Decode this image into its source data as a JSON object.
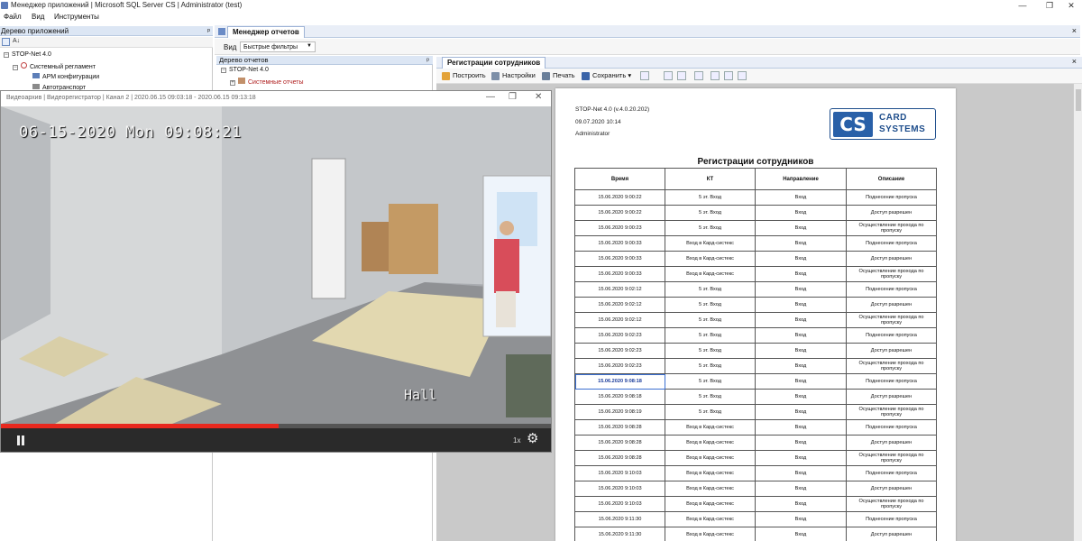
{
  "window": {
    "title": "Менеджер приложений | Microsoft SQL Server CS | Administrator  (test)",
    "controls": [
      "—",
      "❐",
      "✕"
    ]
  },
  "menu": [
    "Файл",
    "Вид",
    "Инструменты"
  ],
  "app_tree": {
    "header": "Дерево приложений",
    "pin": "ᵖ",
    "items": [
      {
        "label": "STOP-Net 4.0"
      },
      {
        "label": "Системный регламент"
      },
      {
        "label": "АРМ конфигурации"
      },
      {
        "label": "Автотранспорт"
      }
    ]
  },
  "report_manager": {
    "tab": "Менеджер отчетов",
    "close": "×",
    "view_label": "Вид",
    "view_select": "Быстрые фильтры",
    "tree_header": "Дерево отчетов",
    "tree_items": [
      {
        "label": "STOP-Net 4.0"
      },
      {
        "label": "Системные отчеты"
      }
    ]
  },
  "report_panel": {
    "tab": "Регистрации сотрудников",
    "close": "×",
    "toolbar": {
      "build": "Построить",
      "settings": "Настройки",
      "print": "Печать",
      "save": "Сохранить"
    }
  },
  "report": {
    "product": "STOP-Net 4.0 (v.4.0.20.202)",
    "date": "09.07.2020 10:14",
    "user": "Administrator",
    "logo_mark": "CS",
    "logo_line1": "CARD",
    "logo_line2": "SYSTEMS",
    "title": "Регистрации сотрудников",
    "columns": [
      "Время",
      "КТ",
      "Направление",
      "Описание"
    ],
    "rows": [
      [
        "15.06.2020 9:00:22",
        "5 эт. Вход",
        "Вход",
        "Поднесение пропуска"
      ],
      [
        "15.06.2020 9:00:22",
        "5 эт. Вход",
        "Вход",
        "Доступ разрешен"
      ],
      [
        "15.06.2020 9:00:23",
        "5 эт. Вход",
        "Вход",
        "Осуществление прохода по пропуску"
      ],
      [
        "15.06.2020 9:00:33",
        "Вход в Кард-систекс",
        "Вход",
        "Поднесение пропуска"
      ],
      [
        "15.06.2020 9:00:33",
        "Вход в Кард-систекс",
        "Вход",
        "Доступ разрешен"
      ],
      [
        "15.06.2020 9:00:33",
        "Вход в Кард-систекс",
        "Вход",
        "Осуществление прохода по пропуску"
      ],
      [
        "15.06.2020 9:02:12",
        "5 эт. Вход",
        "Вход",
        "Поднесение пропуска"
      ],
      [
        "15.06.2020 9:02:12",
        "5 эт. Вход",
        "Вход",
        "Доступ разрешен"
      ],
      [
        "15.06.2020 9:02:12",
        "5 эт. Вход",
        "Вход",
        "Осуществление прохода по пропуску"
      ],
      [
        "15.06.2020 9:02:23",
        "5 эт. Вход",
        "Вход",
        "Поднесение пропуска"
      ],
      [
        "15.06.2020 9:02:23",
        "5 эт. Вход",
        "Вход",
        "Доступ разрешен"
      ],
      [
        "15.06.2020 9:02:23",
        "5 эт. Вход",
        "Вход",
        "Осуществление прохода по пропуску"
      ],
      [
        "15.06.2020 9:08:18",
        "5 эт. Вход",
        "Вход",
        "Поднесение пропуска"
      ],
      [
        "15.06.2020 9:08:18",
        "5 эт. Вход",
        "Вход",
        "Доступ разрешен"
      ],
      [
        "15.06.2020 9:08:19",
        "5 эт. Вход",
        "Вход",
        "Осуществление прохода по пропуску"
      ],
      [
        "15.06.2020 9:08:28",
        "Вход в Кард-систекс",
        "Вход",
        "Поднесение пропуска"
      ],
      [
        "15.06.2020 9:08:28",
        "Вход в Кард-систекс",
        "Вход",
        "Доступ разрешен"
      ],
      [
        "15.06.2020 9:08:28",
        "Вход в Кард-систекс",
        "Вход",
        "Осуществление прохода по пропуску"
      ],
      [
        "15.06.2020 9:10:03",
        "Вход в Кард-систекс",
        "Вход",
        "Поднесение пропуска"
      ],
      [
        "15.06.2020 9:10:03",
        "Вход в Кард-систекс",
        "Вход",
        "Доступ разрешен"
      ],
      [
        "15.06.2020 9:10:03",
        "Вход в Кард-систекс",
        "Вход",
        "Осуществление прохода по пропуску"
      ],
      [
        "15.06.2020 9:11:30",
        "Вход в Кард-систекс",
        "Вход",
        "Поднесение пропуска"
      ],
      [
        "15.06.2020 9:11:30",
        "Вход в Кард-систекс",
        "Вход",
        "Доступ разрешен"
      ]
    ],
    "selected_row": 12
  },
  "video": {
    "title": "Видеоархив | Видеорегистратор | Канал 2 | 2020.06.15 09:03:18 - 2020.06.15 09:13:18",
    "osd_datetime": "06-15-2020 Mon 09:08:21",
    "caption": "Hall",
    "speed": "1x",
    "progress": 0.505,
    "progress_color": "#e8281e"
  }
}
